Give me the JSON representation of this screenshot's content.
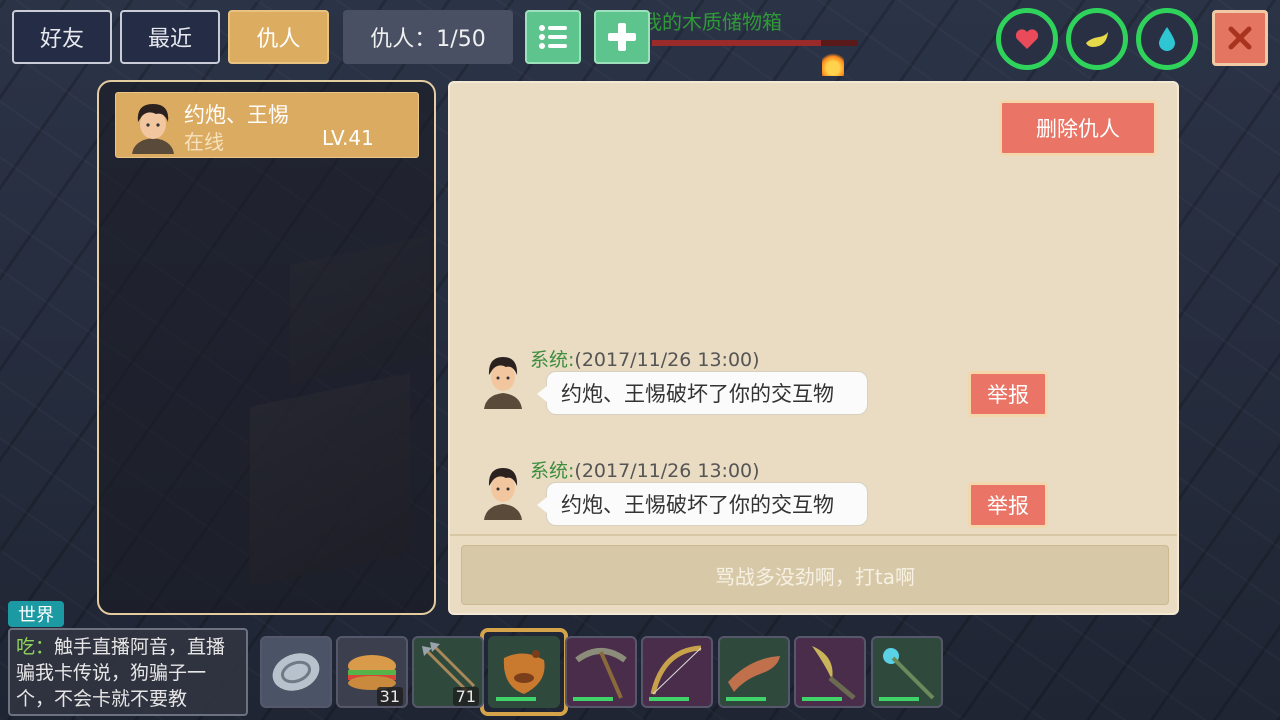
{
  "header": {
    "tabs": [
      {
        "label": "好友",
        "active": false
      },
      {
        "label": "最近",
        "active": false
      },
      {
        "label": "仇人",
        "active": true
      }
    ],
    "enemy_count_label": "仇人：1/50",
    "list_icon": "list-icon",
    "add_icon": "plus-icon",
    "chest_label": "我的木质储物箱",
    "chest_health": 0.82,
    "stats": [
      {
        "icon": "heart-icon",
        "color": "#e94b5b"
      },
      {
        "icon": "hunger-icon",
        "color": "#e6d94a"
      },
      {
        "icon": "water-drop-icon",
        "color": "#2fc6d4"
      }
    ],
    "close_icon": "close-icon"
  },
  "enemy_list": [
    {
      "name": "约炮、王惕",
      "status": "在线",
      "level": "LV.41"
    }
  ],
  "detail": {
    "delete_button": "删除仇人",
    "messages": [
      {
        "sender": "系统:",
        "time": "(2017/11/26 13:00)",
        "text": "约炮、王惕破坏了你的交互物",
        "report": "举报"
      },
      {
        "sender": "系统:",
        "time": "(2017/11/26 13:00)",
        "text": "约炮、王惕破坏了你的交互物",
        "report": "举报"
      }
    ],
    "input_placeholder": "骂战多没劲啊，打ta啊"
  },
  "world_chat": {
    "tag": "世界",
    "speaker": "吃：",
    "text": "触手直播阿音，直播骗我卡传说，狗骗子一个，不会卡就不要教"
  },
  "hotbar": [
    {
      "icon": "shield-disc-icon",
      "count": ""
    },
    {
      "icon": "sandwich-icon",
      "count": "31"
    },
    {
      "icon": "arrows-icon",
      "count": "71"
    },
    {
      "icon": "bag-icon",
      "count": "",
      "selected": true
    },
    {
      "icon": "pickaxe-icon",
      "count": ""
    },
    {
      "icon": "bow-icon",
      "count": ""
    },
    {
      "icon": "boomerang-icon",
      "count": ""
    },
    {
      "icon": "sickle-icon",
      "count": ""
    },
    {
      "icon": "magic-staff-icon",
      "count": ""
    }
  ]
}
